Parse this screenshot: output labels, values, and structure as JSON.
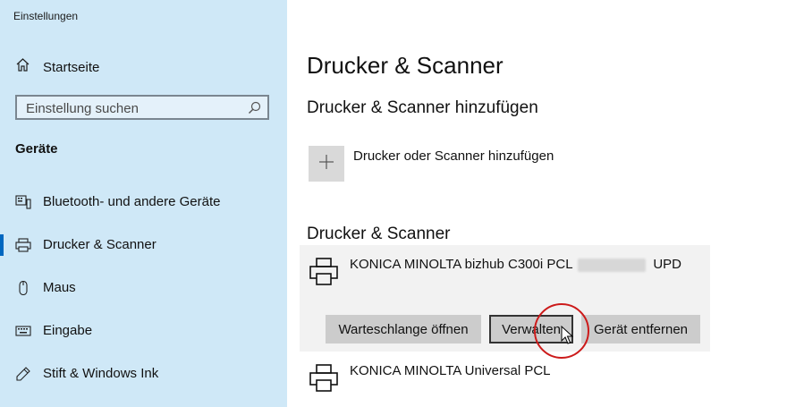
{
  "window": {
    "title": "Einstellungen"
  },
  "sidebar": {
    "home_label": "Startseite",
    "search_placeholder": "Einstellung suchen",
    "section_label": "Geräte",
    "items": [
      {
        "label": "Bluetooth- und andere Geräte",
        "icon": "bluetooth-devices-icon",
        "selected": false
      },
      {
        "label": "Drucker & Scanner",
        "icon": "printer-icon",
        "selected": true
      },
      {
        "label": "Maus",
        "icon": "mouse-icon",
        "selected": false
      },
      {
        "label": "Eingabe",
        "icon": "keyboard-icon",
        "selected": false
      },
      {
        "label": "Stift & Windows Ink",
        "icon": "pen-icon",
        "selected": false
      }
    ]
  },
  "main": {
    "title": "Drucker & Scanner",
    "add_section_title": "Drucker & Scanner hinzufügen",
    "add_button_label": "Drucker oder Scanner hinzufügen",
    "list_section_title": "Drucker & Scanner",
    "printers": [
      {
        "name_prefix": "KONICA MINOLTA bizhub C300i PCL",
        "name_suffix": "UPD",
        "expanded": true,
        "actions": {
          "queue": "Warteschlange öffnen",
          "manage": "Verwalten",
          "remove": "Gerät entfernen"
        }
      },
      {
        "name": "KONICA MINOLTA Universal PCL",
        "expanded": false
      }
    ]
  },
  "colors": {
    "sidebar_bg": "#cfe8f7",
    "accent": "#0067c0",
    "button_bg": "#cccccc",
    "annotation_red": "#cc1a1a"
  }
}
